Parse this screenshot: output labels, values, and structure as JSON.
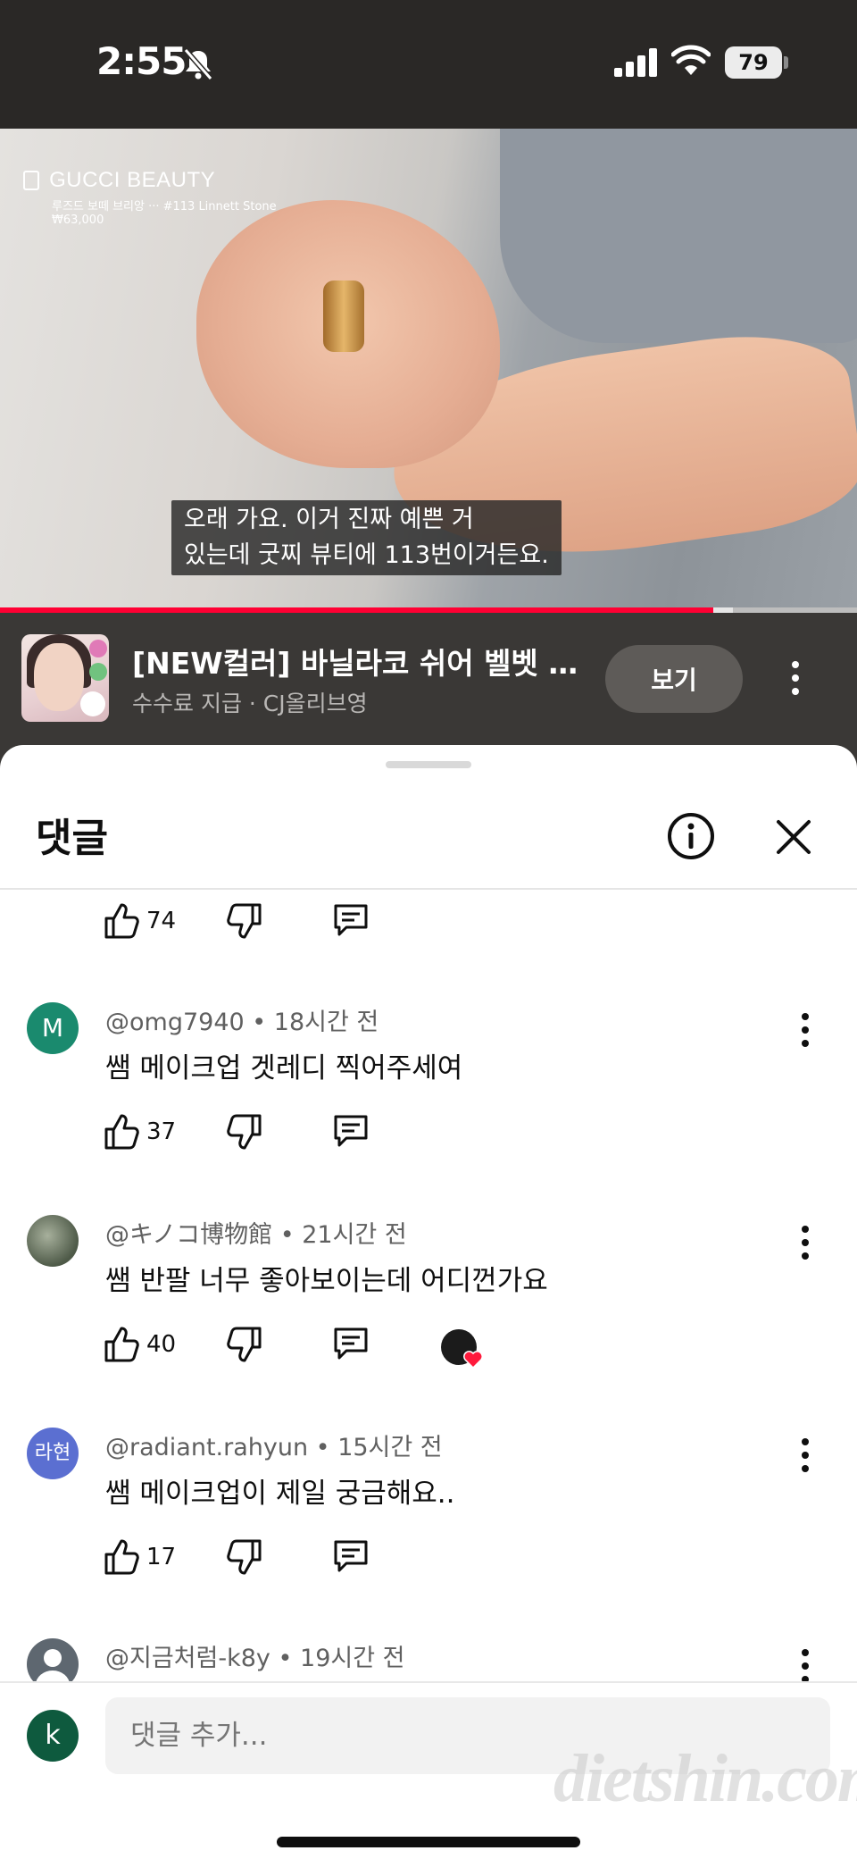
{
  "status": {
    "time": "2:55",
    "battery": "79"
  },
  "video": {
    "brand": "GUCCI BEAUTY",
    "brand_sub": "루즈드 보떼 브리앙 ··· #113 Linnett Stone",
    "brand_price": "₩63,000",
    "caption_line1": "오래 가요. 이거 진짜 예쁜 거",
    "caption_line2": "있는데 굿찌 뷰티에 113번이거든요.",
    "progress": 0.832,
    "buffered": 0.855
  },
  "product": {
    "title": "[NEW컬러] 바닐라코 쉬어 벨벳 베...",
    "subtitle": "수수료 지급 · CJ올리브영",
    "view_label": "보기"
  },
  "comments_panel": {
    "title": "댓글",
    "prev_actions": {
      "likes": "74"
    },
    "comments": [
      {
        "author": "@omg7940",
        "time": "18시간 전",
        "text": "쌤 메이크업 겟레디 찍어주세여",
        "likes": "37",
        "avatar_text": "M",
        "avatar_color": "#1a8a6e"
      },
      {
        "author": "@キノコ博物館",
        "time": "21시간 전",
        "text": "쌤 반팔 너무 좋아보이는데 어디껀가요",
        "likes": "40",
        "avatar_text": "",
        "avatar_color": "#6b7a6a"
      },
      {
        "author": "@radiant.rahyun",
        "time": "15시간 전",
        "text": "쌤 메이크업이 제일 궁금해요..",
        "likes": "17",
        "avatar_text": "라현",
        "avatar_color": "#5b6fd1"
      },
      {
        "author": "@지금처럼-k8y",
        "time": "19시간 전",
        "text": "",
        "likes": "",
        "avatar_text": "",
        "avatar_color": "#5e6770"
      }
    ],
    "input_placeholder": "댓글 추가...",
    "my_avatar": "k"
  },
  "watermark": "dietshin.com",
  "colors": {
    "accent_red": "#ff0033",
    "heart": "#ff1a3c"
  }
}
